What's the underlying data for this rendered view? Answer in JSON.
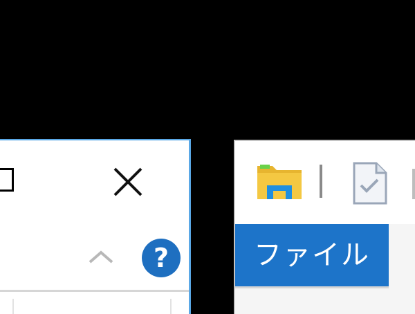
{
  "left_window": {
    "help_label": "?",
    "icons": {
      "maximize": "maximize-icon",
      "close": "close-icon",
      "collapse": "chevron-up-icon",
      "help": "help-icon"
    }
  },
  "right_window": {
    "file_tab_label": "ファイル",
    "icons": {
      "quick_access_folder": "folder-icon",
      "properties": "properties-icon"
    }
  },
  "colors": {
    "accent_blue": "#1d74c9",
    "help_blue": "#1e6fc0",
    "window_border": "#5aa8e6",
    "folder_yellow": "#f4c842",
    "background": "#000000"
  }
}
